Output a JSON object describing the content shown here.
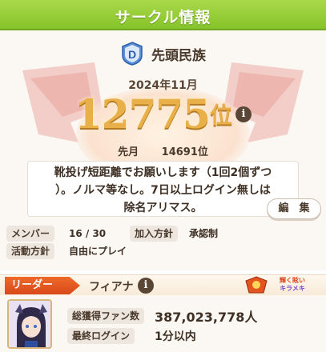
{
  "header": {
    "title": "サークル情報"
  },
  "circle": {
    "name": "先頭民族",
    "logo_letter": "D",
    "period": "2024年11月",
    "rank": "12775",
    "rank_suffix": "位",
    "prev_label": "先月",
    "prev_rank": "14691位",
    "message_lines": [
      "靴投げ短距離でお願いします（1回2個ずつ",
      "）。ノルマ等なし。7日以上ログイン無しは",
      "除名アリマス。"
    ]
  },
  "fields": {
    "members_label": "メンバー",
    "members_value": "16 / 30",
    "join_label": "加入方針",
    "join_value": "承認制",
    "activity_label": "活動方針",
    "activity_value": "自由にプレイ"
  },
  "edit_button": "編　集",
  "leader": {
    "tag": "リーダー",
    "name": "フィアナ",
    "badge_line1": "輝く眩い",
    "badge_line2": "キラメキ",
    "fans_label": "総獲得ファン数",
    "fans_value": "387,023,778人",
    "login_label": "最終ログイン",
    "login_value": "1分以内"
  },
  "info_icon": "i",
  "colors": {
    "header_green": "#8cc63f",
    "rank_gold": "#e9b04a",
    "leader_orange": "#e4541f",
    "panel_bg": "#fbf7f3"
  }
}
